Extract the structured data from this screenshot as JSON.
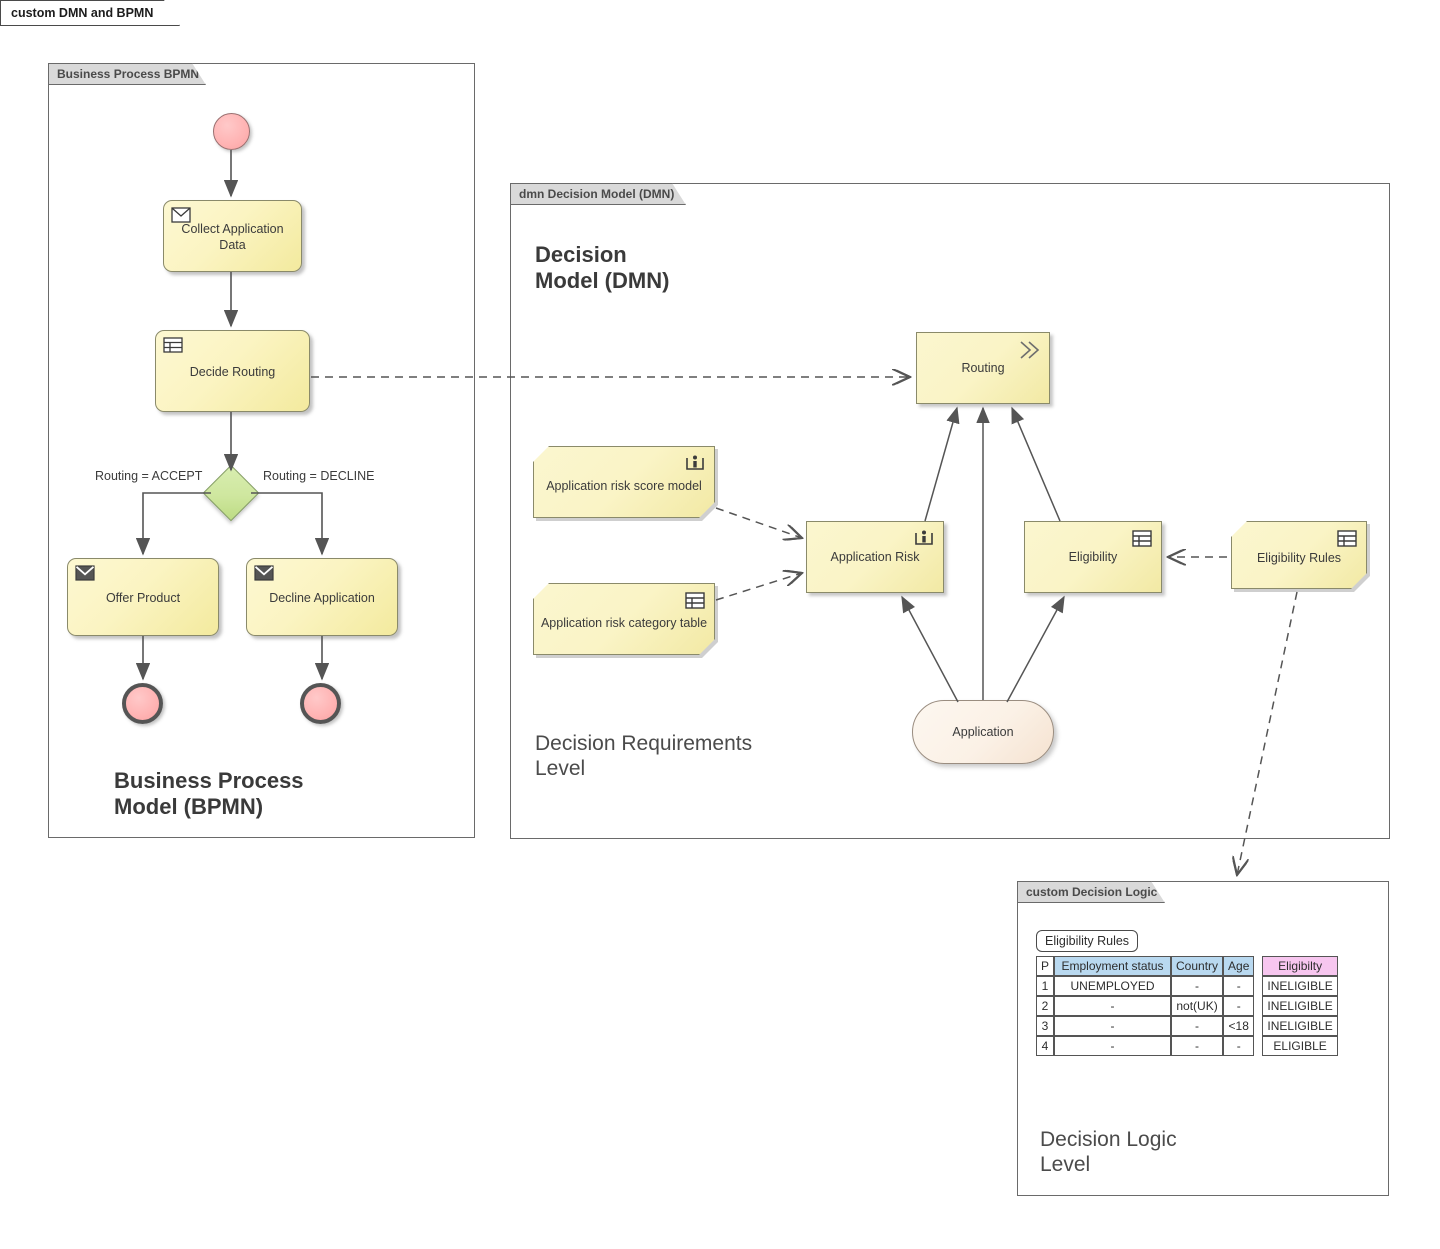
{
  "diagram": {
    "title": "custom DMN and BPMN"
  },
  "frames": {
    "bpmn": {
      "tab": "Business Process BPMN",
      "caption": "Business Process\nModel (BPMN)"
    },
    "dmn": {
      "tab": "dmn Decision Model (DMN)",
      "title": "Decision\nModel (DMN)",
      "caption": "Decision Requirements\nLevel"
    },
    "logic": {
      "tab": "custom Decision Logic",
      "caption": "Decision Logic\nLevel"
    }
  },
  "bpmn": {
    "start_event": "start-event",
    "tasks": [
      {
        "label": "Collect Application\nData",
        "icon": "envelope-icon"
      },
      {
        "label": "Decide Routing",
        "icon": "table-icon"
      },
      {
        "label": "Offer Product",
        "icon": "envelope-filled-icon"
      },
      {
        "label": "Decline Application",
        "icon": "envelope-filled-icon"
      }
    ],
    "gateway": "exclusive-gateway",
    "flow_labels": [
      "Routing = ACCEPT",
      "Routing = DECLINE"
    ],
    "end_events": [
      "end-event-accept",
      "end-event-decline"
    ]
  },
  "dmn": {
    "decisions": [
      {
        "label": "Routing",
        "icon": "chevron-double-icon"
      },
      {
        "label": "Application Risk",
        "icon": "bkm-person-icon"
      },
      {
        "label": "Eligibility",
        "icon": "table-icon"
      }
    ],
    "knowledge_sources": [
      {
        "label": "Application risk score model",
        "icon": "bkm-person-icon"
      },
      {
        "label": "Application risk category table",
        "icon": "table-icon"
      },
      {
        "label": "Eligibility Rules",
        "icon": "table-icon"
      }
    ],
    "input_data": [
      {
        "label": "Application"
      }
    ]
  },
  "decision_table": {
    "name": "Eligibility Rules",
    "headers": [
      "P",
      "Employment status",
      "Country",
      "Age",
      "Eligibilty"
    ],
    "rows": [
      {
        "p": "1",
        "employment": "UNEMPLOYED",
        "country": "-",
        "age": "-",
        "eligibility": "INELIGIBLE"
      },
      {
        "p": "2",
        "employment": "-",
        "country": "not(UK)",
        "age": "-",
        "eligibility": "INELIGIBLE"
      },
      {
        "p": "3",
        "employment": "-",
        "country": "-",
        "age": "<18",
        "eligibility": "INELIGIBLE"
      },
      {
        "p": "4",
        "employment": "-",
        "country": "-",
        "age": "-",
        "eligibility": "ELIGIBLE"
      }
    ]
  },
  "colors": {
    "shape_fill": "#faf4c6",
    "shape_border": "#8a8a6a",
    "event_fill": "#ffb3b3",
    "gateway_fill": "#cfe79f",
    "input_fill": "#fbf1e6",
    "table_input_header": "#b9d9f0",
    "table_output_header": "#f7c6ef",
    "frame_tab": "#d9d9d9"
  }
}
